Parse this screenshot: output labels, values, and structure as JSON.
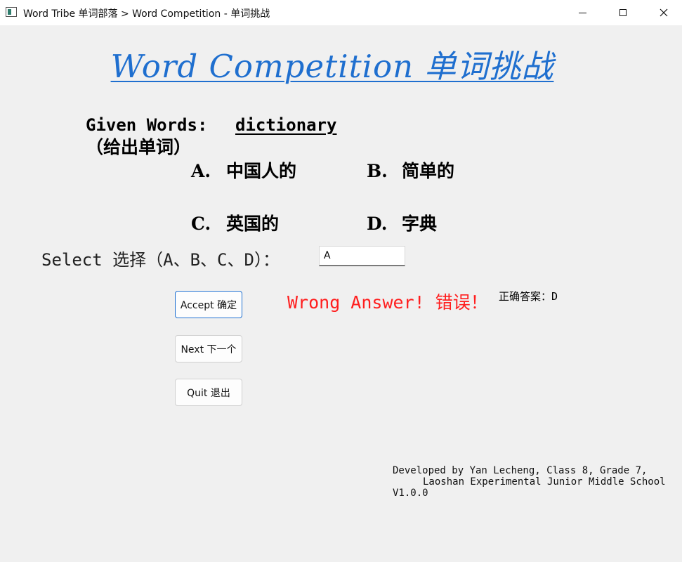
{
  "window": {
    "title": "Word Tribe 单词部落 > Word Competition - 单词挑战",
    "icons": [
      "app-icon",
      "minimize-icon",
      "maximize-icon",
      "close-icon"
    ]
  },
  "heading": "Word Competition 单词挑战",
  "given": {
    "label": "Given Words:",
    "word": "dictionary",
    "label_cn": "（给出单词）"
  },
  "options": [
    {
      "letter": "A.",
      "text": "中国人的"
    },
    {
      "letter": "B.",
      "text": "简单的"
    },
    {
      "letter": "C.",
      "text": "英国的"
    },
    {
      "letter": "D.",
      "text": "字典"
    }
  ],
  "select": {
    "label": "Select 选择（A、B、C、D）：",
    "value": "A"
  },
  "buttons": {
    "accept": "Accept 确定",
    "next": "Next 下一个",
    "quit": "Quit 退出"
  },
  "result": {
    "message": "Wrong Answer! 错误！",
    "correct_answer": "正确答案：D",
    "message_color": "#ff1e1e"
  },
  "credits": {
    "line1": "Developed by Yan Lecheng, Class 8, Grade 7,",
    "line2": "Laoshan Experimental Junior Middle School",
    "version": "V1.0.0"
  },
  "colors": {
    "heading": "#1f6fcf",
    "background": "#f0f0f0",
    "accept_border": "#1e6fd0"
  }
}
